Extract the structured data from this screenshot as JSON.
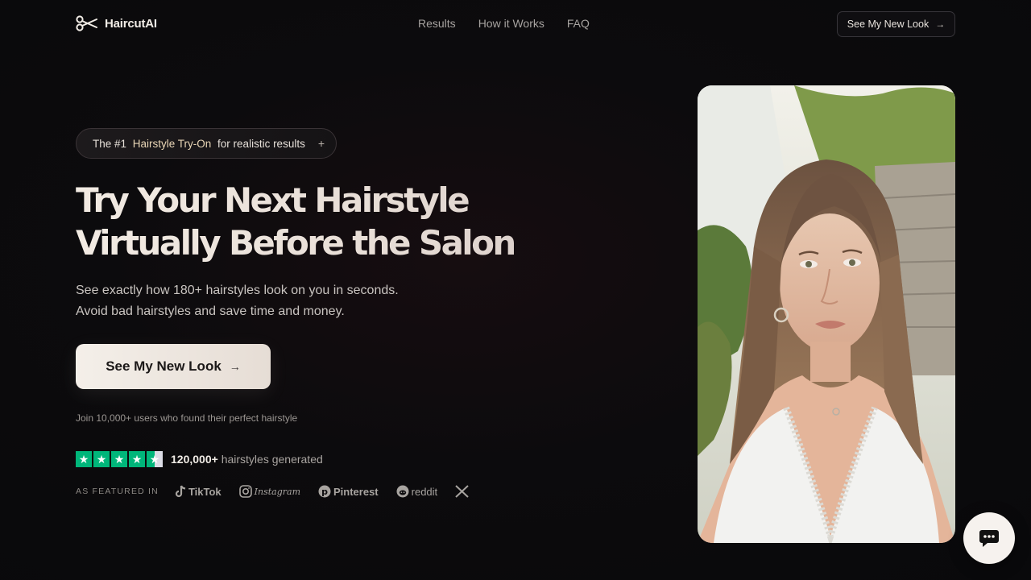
{
  "header": {
    "brand": "HaircutAI",
    "nav": [
      "Results",
      "How it Works",
      "FAQ"
    ],
    "cta_label": "See My New Look"
  },
  "hero": {
    "badge": {
      "prefix": "The #1 ",
      "highlight": "Hairstyle Try-On",
      "suffix": " for realistic results"
    },
    "headline_line1": "Try Your Next Hairstyle",
    "headline_line2": "Virtually Before the Salon",
    "sub_line1": "See exactly how 180+ hairstyles look on you in seconds.",
    "sub_line2": "Avoid bad hairstyles and save time and money.",
    "cta_label": "See My New Look",
    "join_text": "Join 10,000+ users who found their perfect hairstyle",
    "rating": {
      "stars": 4.5,
      "count": "120,000+",
      "label": "hairstyles generated"
    },
    "featured_label": "AS FEATURED IN",
    "featured_brands": [
      "TikTok",
      "Instagram",
      "Pinterest",
      "reddit",
      "X"
    ]
  },
  "colors": {
    "background": "#09090b",
    "accent": "#e9d6b6",
    "trustpilot": "#00b67a"
  }
}
